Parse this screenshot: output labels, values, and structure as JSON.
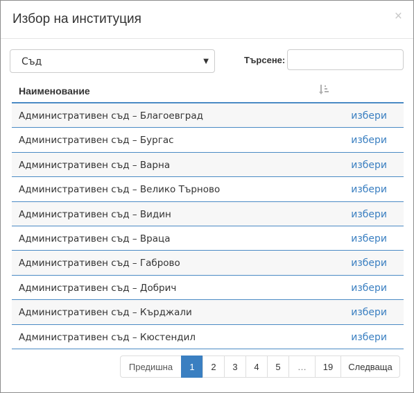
{
  "modal": {
    "title": "Избор на институция",
    "close_glyph": "×"
  },
  "filter": {
    "selected": "Съд",
    "caret_icon": "caret-down-icon"
  },
  "search": {
    "label": "Търсене:",
    "value": "",
    "placeholder": ""
  },
  "table": {
    "columns": [
      "Наименование"
    ],
    "sort_icon": "sort-amount-icon",
    "link_color": "#3a7fc1",
    "border_color": "#4a8ac4",
    "rows": [
      {
        "name": "Административен съд – Благоевград",
        "action": "избери"
      },
      {
        "name": "Административен съд – Бургас",
        "action": "избери"
      },
      {
        "name": "Административен съд – Варна",
        "action": "избери"
      },
      {
        "name": "Административен съд – Велико Търново",
        "action": "избери"
      },
      {
        "name": "Административен съд – Видин",
        "action": "избери"
      },
      {
        "name": "Административен съд – Враца",
        "action": "избери"
      },
      {
        "name": "Административен съд – Габрово",
        "action": "избери"
      },
      {
        "name": "Административен съд – Добрич",
        "action": "избери"
      },
      {
        "name": "Административен съд – Кърджали",
        "action": "избери"
      },
      {
        "name": "Административен съд – Кюстендил",
        "action": "избери"
      }
    ]
  },
  "pagination": {
    "prev": "Предишна",
    "pages": [
      "1",
      "2",
      "3",
      "4",
      "5"
    ],
    "active": "1",
    "ellipsis": "…",
    "last": "19",
    "next": "Следваща",
    "active_color": "#3a7fc1"
  }
}
